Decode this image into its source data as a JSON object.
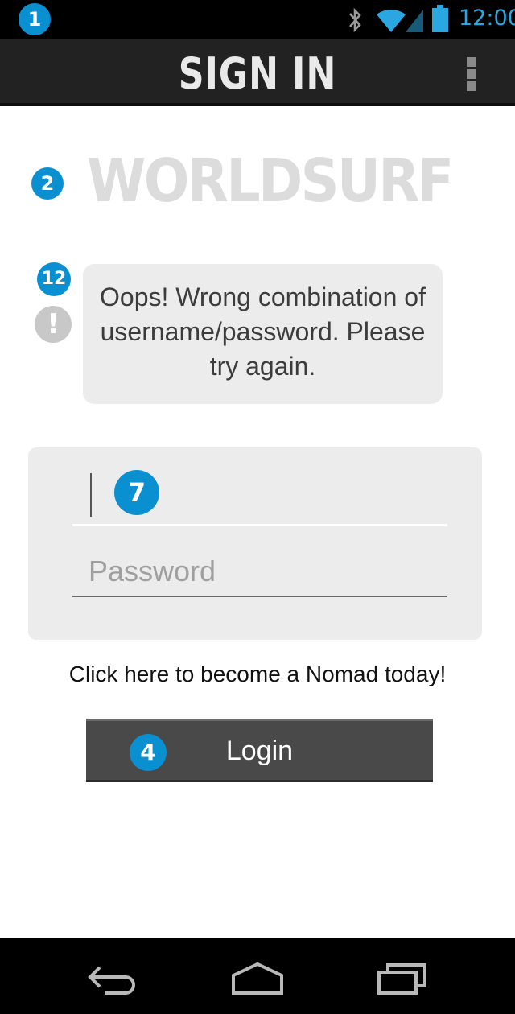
{
  "status_bar": {
    "time": "12:00",
    "icons": [
      "bluetooth-icon",
      "wifi-icon",
      "signal-icon",
      "battery-icon"
    ]
  },
  "action_bar": {
    "title": "SIGN IN",
    "overflow_icon": "overflow-menu-icon"
  },
  "markers": {
    "m1": "1",
    "m2": "2",
    "m12": "12",
    "m7": "7",
    "m4": "4"
  },
  "logo": {
    "text": "WORLDSURF"
  },
  "error": {
    "icon_glyph": "!",
    "message": "Oops! Wrong combination of username/password. Please try again."
  },
  "form": {
    "username_value": "",
    "password_placeholder": "Password"
  },
  "signup_link": "Click here to become a Nomad today!",
  "login_button": "Login",
  "nav_bar": {
    "icons": [
      "back-icon",
      "home-icon",
      "recent-apps-icon"
    ]
  },
  "colors": {
    "accent": "#0a8fd0",
    "clock": "#2aa6e0",
    "action_bar": "#222222",
    "button": "#494949",
    "card": "#ececec"
  }
}
